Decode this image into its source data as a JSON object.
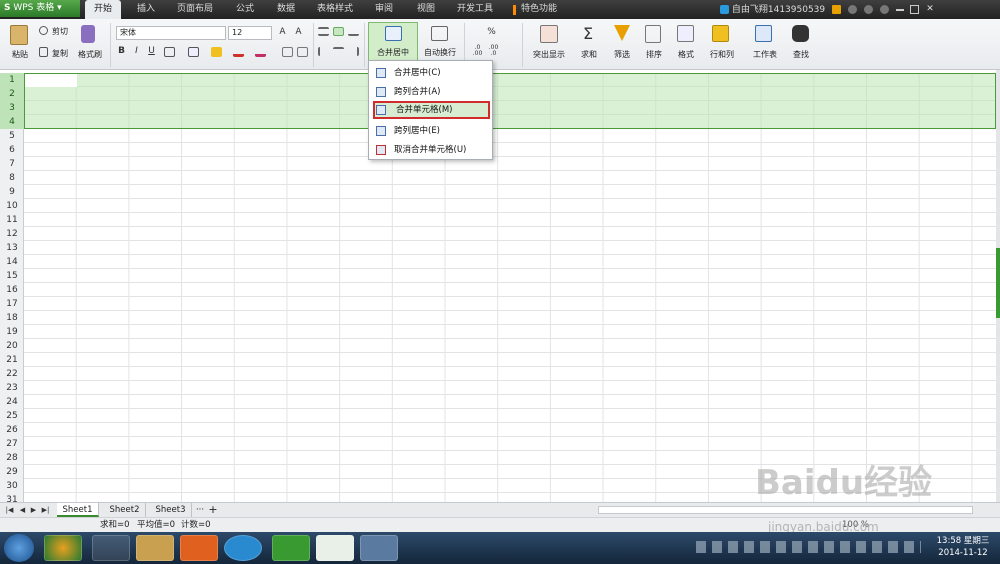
{
  "app": {
    "logo_s": "S",
    "logo_text": "WPS 表格",
    "logo_arrow": "▾"
  },
  "menu_tabs": [
    {
      "label": "开始",
      "active": true
    },
    {
      "label": "插入"
    },
    {
      "label": "页面布局"
    },
    {
      "label": "公式"
    },
    {
      "label": "数据"
    },
    {
      "label": "表格样式"
    },
    {
      "label": "审阅"
    },
    {
      "label": "视图"
    },
    {
      "label": "开发工具"
    },
    {
      "label": "特色功能"
    }
  ],
  "user": {
    "name": "自由飞翔1413950539"
  },
  "ribbon": {
    "paste": "粘贴",
    "cut": "剪切",
    "copy": "复制",
    "format_painter": "格式刷",
    "font_name": "宋体",
    "font_size": "12",
    "bold": "B",
    "italic": "I",
    "underline": "U",
    "merge_center": "合并居中",
    "wrap_text": "自动换行",
    "percent": "%",
    "highlight": "突出显示",
    "sum": "求和",
    "filter": "筛选",
    "sort": "排序",
    "format": "格式",
    "rows_cols": "行和列",
    "worksheet": "工作表",
    "find": "查找",
    "dec_inc": ".0\n.00",
    "dec_dec": ".00\n.0"
  },
  "rows": [
    "1",
    "2",
    "3",
    "4",
    "5",
    "6",
    "7",
    "8",
    "9",
    "10",
    "11",
    "12",
    "13",
    "14",
    "15",
    "16",
    "17",
    "18",
    "19",
    "20",
    "21",
    "22",
    "23",
    "24",
    "25",
    "26",
    "27",
    "28",
    "29",
    "30",
    "31"
  ],
  "dropdown": {
    "items": [
      {
        "label": "合并居中(C)"
      },
      {
        "label": "跨列合并(A)"
      },
      {
        "label": "合并单元格(M)",
        "highlighted": true
      },
      {
        "label": "跨列居中(E)"
      },
      {
        "label": "取消合并单元格(U)"
      }
    ]
  },
  "sheets": [
    "Sheet1",
    "Sheet2",
    "Sheet3"
  ],
  "sheet_more": "···",
  "sheet_add": "+",
  "status": {
    "sum": "求和=0",
    "avg": "平均值=0",
    "count": "计数=0",
    "zoom": "100 %"
  },
  "clock": {
    "time": "13:58 星期三",
    "date": "2014-11-12"
  },
  "watermark": {
    "text": "Baidu经验",
    "url": "jingyan.baidu.com"
  },
  "colors": {
    "accent": "#3a9a32",
    "highlight_border": "#d22b2b"
  }
}
